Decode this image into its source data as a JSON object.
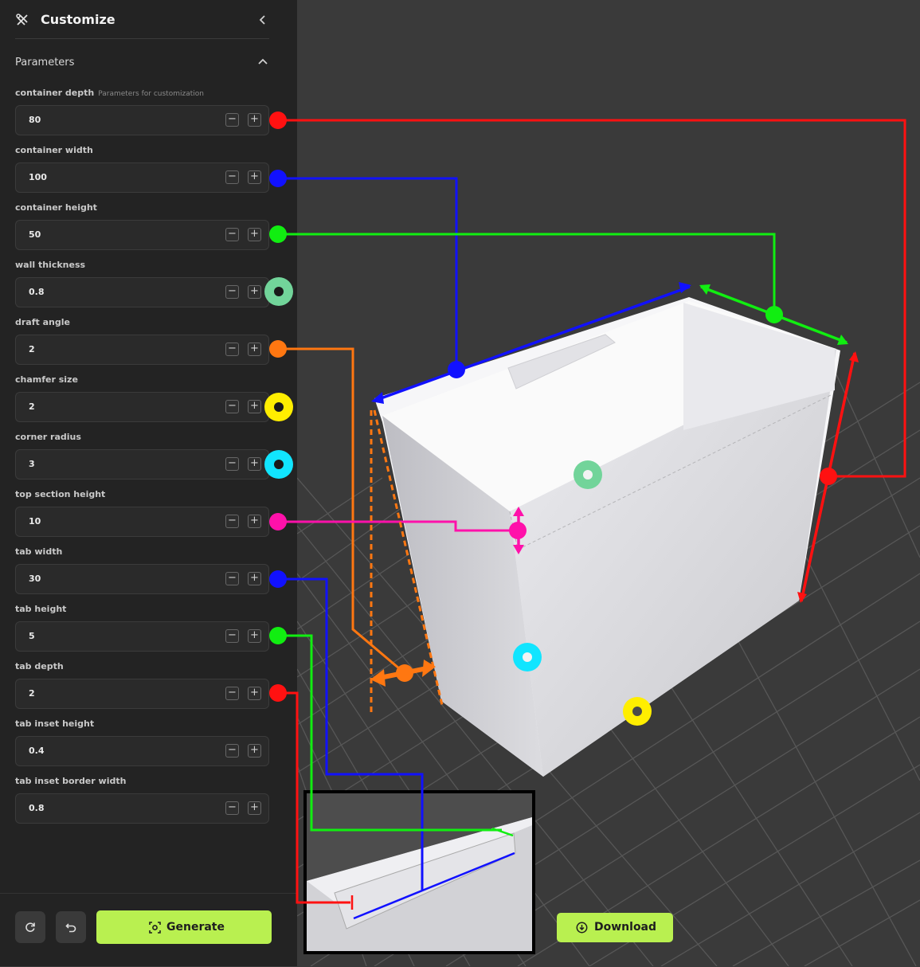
{
  "sidebar": {
    "title": "Customize",
    "section_title": "Parameters",
    "params": [
      {
        "label": "container depth",
        "hint": "Parameters for customization",
        "value": "80"
      },
      {
        "label": "container width",
        "value": "100"
      },
      {
        "label": "container height",
        "value": "50"
      },
      {
        "label": "wall thickness",
        "value": "0.8"
      },
      {
        "label": "draft angle",
        "value": "2"
      },
      {
        "label": "chamfer size",
        "value": "2"
      },
      {
        "label": "corner radius",
        "value": "3"
      },
      {
        "label": "top section height",
        "value": "10"
      },
      {
        "label": "tab width",
        "value": "30"
      },
      {
        "label": "tab height",
        "value": "5"
      },
      {
        "label": "tab depth",
        "value": "2"
      },
      {
        "label": "tab inset height",
        "value": "0.4"
      },
      {
        "label": "tab inset border width",
        "value": "0.8"
      }
    ],
    "minus_symbol": "−",
    "plus_symbol": "+",
    "generate_label": "Generate"
  },
  "viewer": {
    "download_label": "Download"
  },
  "icons": {
    "title": "customize-icon",
    "collapse": "chevron-left-icon",
    "section": "chevron-up-icon",
    "reset": "refresh-icon",
    "undo": "undo-icon",
    "generate": "generate-icon",
    "download": "download-icon"
  },
  "colors": {
    "accent": "#b9f050",
    "sidebar_bg": "#232323",
    "viewport_bg": "#3a3a3a"
  }
}
